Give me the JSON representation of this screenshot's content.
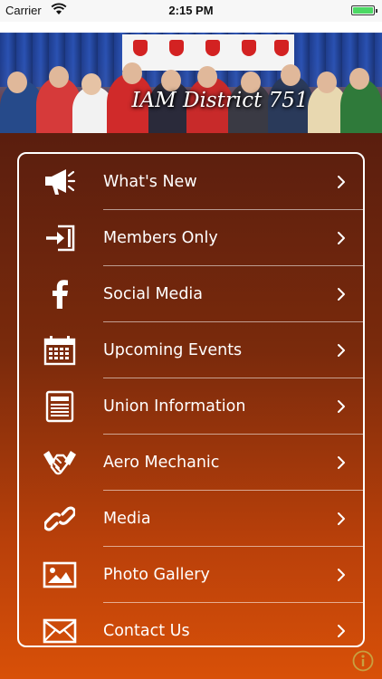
{
  "status_bar": {
    "carrier": "Carrier",
    "time": "2:15 PM",
    "battery_level": 1.0
  },
  "header": {
    "caption": "IAM District 751"
  },
  "menu": {
    "items": [
      {
        "label": "What's New",
        "icon": "megaphone-icon"
      },
      {
        "label": "Members Only",
        "icon": "sign-in-icon"
      },
      {
        "label": "Social Media",
        "icon": "facebook-icon"
      },
      {
        "label": "Upcoming Events",
        "icon": "calendar-icon"
      },
      {
        "label": "Union Information",
        "icon": "newspaper-icon"
      },
      {
        "label": "Aero Mechanic",
        "icon": "handshake-icon"
      },
      {
        "label": "Media",
        "icon": "link-icon"
      },
      {
        "label": "Photo Gallery",
        "icon": "picture-icon"
      },
      {
        "label": "Contact Us",
        "icon": "envelope-icon"
      }
    ]
  },
  "colors": {
    "accent": "#d85008",
    "gradient_top": "#5a1e0e",
    "battery": "#4cd964",
    "info": "#c8a040"
  }
}
